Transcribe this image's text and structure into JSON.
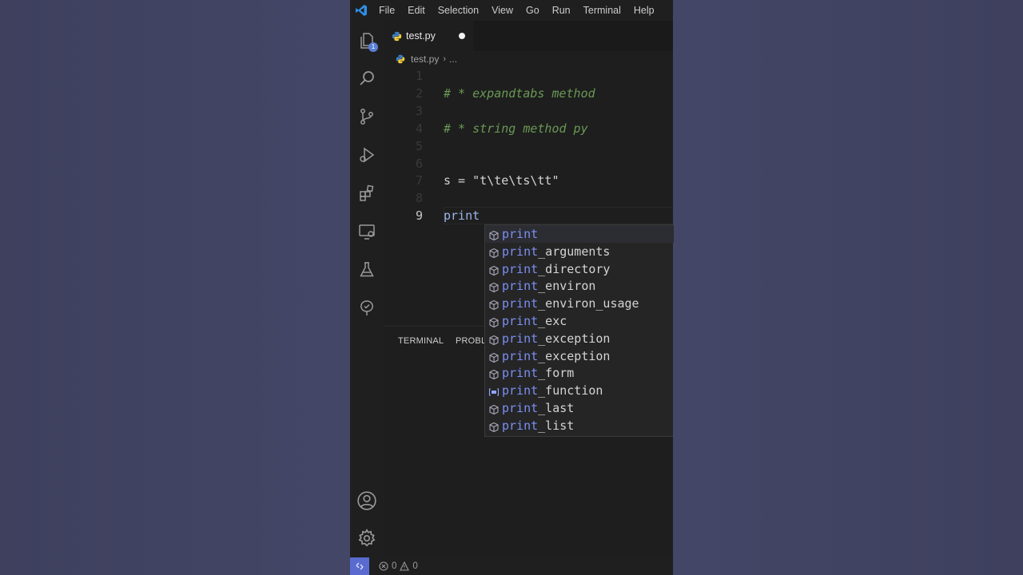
{
  "menu": [
    "File",
    "Edit",
    "Selection",
    "View",
    "Go",
    "Run",
    "Terminal",
    "Help"
  ],
  "tab": {
    "name": "test.py",
    "modified": true
  },
  "breadcrumb": {
    "file": "test.py",
    "ellipsis": "..."
  },
  "badges": {
    "explorer": "1"
  },
  "editor": {
    "lines": [
      {
        "num": "1",
        "text": ""
      },
      {
        "num": "2",
        "text": "# * expandtabs method",
        "kind": "comment"
      },
      {
        "num": "3",
        "text": ""
      },
      {
        "num": "4",
        "text": "# * string method py",
        "kind": "comment"
      },
      {
        "num": "5",
        "text": ""
      },
      {
        "num": "6",
        "text": ""
      },
      {
        "num": "7",
        "text": "s = \"t\\te\\ts\\tt\""
      },
      {
        "num": "8",
        "text": ""
      },
      {
        "num": "9",
        "text": "print"
      }
    ],
    "active_line": "9"
  },
  "suggestions": {
    "typed": "print",
    "items": [
      {
        "rest": "",
        "icon": "cube-icon",
        "selected": true
      },
      {
        "rest": "_arguments",
        "icon": "cube-icon"
      },
      {
        "rest": "_directory",
        "icon": "cube-icon"
      },
      {
        "rest": "_environ",
        "icon": "cube-icon"
      },
      {
        "rest": "_environ_usage",
        "icon": "cube-icon"
      },
      {
        "rest": "_exc",
        "icon": "cube-icon"
      },
      {
        "rest": "_exception",
        "icon": "cube-icon"
      },
      {
        "rest": "_exception",
        "icon": "cube-icon"
      },
      {
        "rest": "_form",
        "icon": "cube-icon"
      },
      {
        "rest": "_function",
        "icon": "variable-icon"
      },
      {
        "rest": "_last",
        "icon": "cube-icon"
      },
      {
        "rest": "_list",
        "icon": "cube-icon"
      }
    ]
  },
  "panel": {
    "tabs": [
      "TERMINAL",
      "PROBLE"
    ]
  },
  "status": {
    "errors": "0",
    "warnings": "0"
  },
  "colors": {
    "comment": "#6a9955",
    "match": "#7a8ff0",
    "remote": "#5a6bd0",
    "background": "#404262"
  }
}
